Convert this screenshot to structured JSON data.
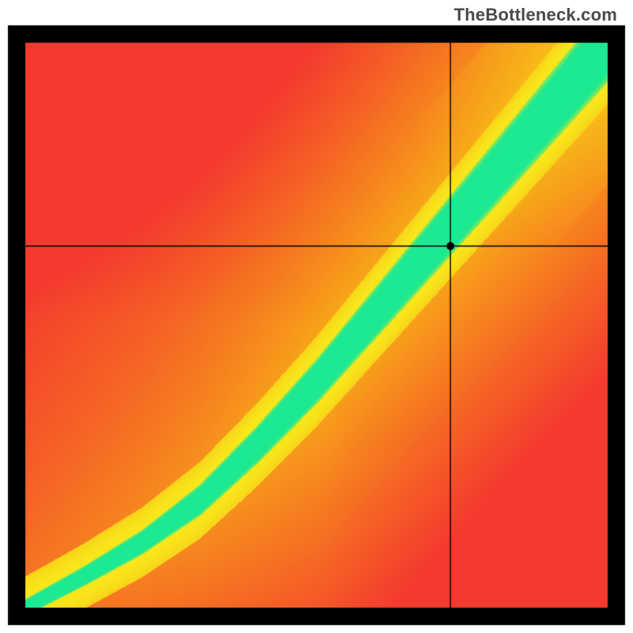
{
  "watermark": "TheBottleneck.com",
  "chart_data": {
    "type": "heatmap",
    "title": "",
    "xlabel": "",
    "ylabel": "",
    "xlim": [
      0,
      1
    ],
    "ylim": [
      0,
      1
    ],
    "frame": {
      "outer_margin": 10,
      "border_width": 22,
      "top_offset": 32
    },
    "crosshair": {
      "x": 0.73,
      "y": 0.64
    },
    "colors": {
      "red": "#f43a2f",
      "orange": "#f99410",
      "yellow": "#f8e71c",
      "green": "#1de993",
      "border": "#000000"
    },
    "ridge": {
      "segments": [
        {
          "x": 0.0,
          "y": 0.0,
          "half_width": 0.015
        },
        {
          "x": 0.1,
          "y": 0.055,
          "half_width": 0.018
        },
        {
          "x": 0.2,
          "y": 0.115,
          "half_width": 0.022
        },
        {
          "x": 0.3,
          "y": 0.19,
          "half_width": 0.028
        },
        {
          "x": 0.4,
          "y": 0.29,
          "half_width": 0.034
        },
        {
          "x": 0.5,
          "y": 0.4,
          "half_width": 0.04
        },
        {
          "x": 0.6,
          "y": 0.52,
          "half_width": 0.046
        },
        {
          "x": 0.7,
          "y": 0.64,
          "half_width": 0.052
        },
        {
          "x": 0.8,
          "y": 0.76,
          "half_width": 0.058
        },
        {
          "x": 0.9,
          "y": 0.88,
          "half_width": 0.064
        },
        {
          "x": 1.0,
          "y": 1.0,
          "half_width": 0.07
        }
      ],
      "yellow_extra": 0.04
    },
    "background_skew": 0.55
  }
}
